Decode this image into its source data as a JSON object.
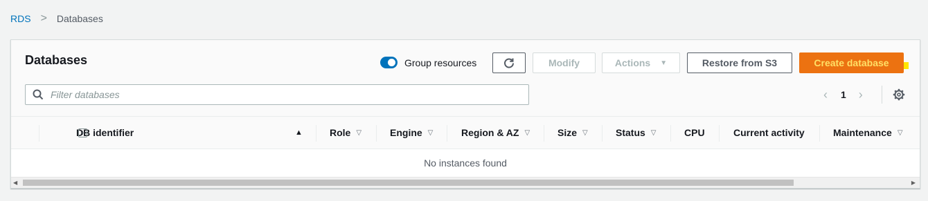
{
  "breadcrumb": {
    "root": "RDS",
    "separator": ">",
    "current": "Databases"
  },
  "panel": {
    "title": "Databases"
  },
  "toolbar": {
    "group_resources_label": "Group resources",
    "group_resources_on": true,
    "refresh_icon": "refresh-icon",
    "modify_label": "Modify",
    "actions_label": "Actions",
    "restore_label": "Restore from S3",
    "create_label": "Create database"
  },
  "filter": {
    "placeholder": "Filter databases",
    "value": ""
  },
  "pagination": {
    "current_page": "1"
  },
  "table": {
    "columns": [
      {
        "label": "DB identifier",
        "sort": "ascending"
      },
      {
        "label": "Role",
        "sort": "none"
      },
      {
        "label": "Engine",
        "sort": "none"
      },
      {
        "label": "Region & AZ",
        "sort": "none"
      },
      {
        "label": "Size",
        "sort": "none"
      },
      {
        "label": "Status",
        "sort": "none"
      },
      {
        "label": "CPU",
        "sort": "none"
      },
      {
        "label": "Current activity",
        "sort": "none"
      },
      {
        "label": "Maintenance",
        "sort": "none"
      }
    ],
    "empty_message": "No instances found"
  },
  "colors": {
    "accent": "#0073bb",
    "primary_button": "#ec7211",
    "primary_text": "#ffe066"
  }
}
